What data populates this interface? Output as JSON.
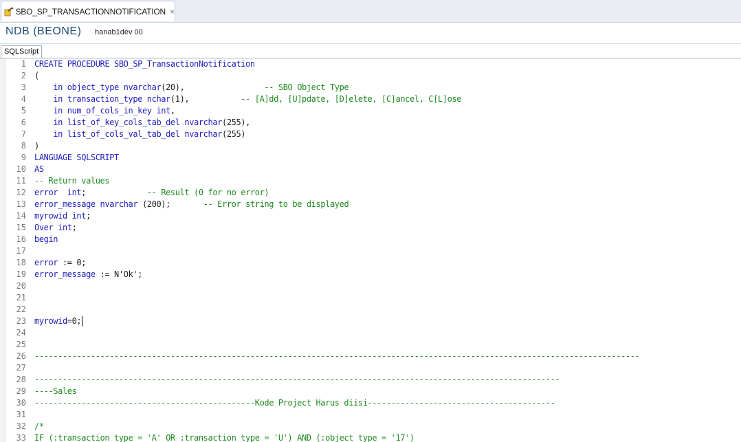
{
  "tab": {
    "title": "SBO_SP_TRANSACTIONNOTIFICATION",
    "close_glyph": "×",
    "icon": "procedure-icon"
  },
  "header": {
    "db_name": "NDB (BEONE)",
    "host": "hanab1dev 00"
  },
  "subtab": {
    "label": "SQLScript"
  },
  "colors": {
    "keyword": "#1f1fc0",
    "comment": "#1f8a1f",
    "text": "#202020",
    "line_number": "#787878",
    "db_name": "#1c4a7a"
  },
  "editor": {
    "cursor_line": 23,
    "lines": [
      {
        "n": "1",
        "segments": [
          {
            "t": "CREATE PROCEDURE SBO_SP_TransactionNotification",
            "c": "kw"
          }
        ]
      },
      {
        "n": "2",
        "segments": [
          {
            "t": "(",
            "c": "tx"
          }
        ]
      },
      {
        "n": "3",
        "segments": [
          {
            "t": "    in object_type nvarchar",
            "c": "kw"
          },
          {
            "t": "(20),                 ",
            "c": "tx"
          },
          {
            "t": "-- SBO Object Type",
            "c": "cm"
          }
        ]
      },
      {
        "n": "4",
        "segments": [
          {
            "t": "    in transaction_type nchar",
            "c": "kw"
          },
          {
            "t": "(1),           ",
            "c": "tx"
          },
          {
            "t": "-- [A]dd, [U]pdate, [D]elete, [C]ancel, C[L]ose",
            "c": "cm"
          }
        ]
      },
      {
        "n": "5",
        "segments": [
          {
            "t": "    in num_of_cols_in_key int",
            "c": "kw"
          },
          {
            "t": ",",
            "c": "tx"
          }
        ]
      },
      {
        "n": "6",
        "segments": [
          {
            "t": "    in list_of_key_cols_tab_del nvarchar",
            "c": "kw"
          },
          {
            "t": "(255),",
            "c": "tx"
          }
        ]
      },
      {
        "n": "7",
        "segments": [
          {
            "t": "    in list_of_cols_val_tab_del nvarchar",
            "c": "kw"
          },
          {
            "t": "(255)",
            "c": "tx"
          }
        ]
      },
      {
        "n": "8",
        "segments": [
          {
            "t": ")",
            "c": "tx"
          }
        ]
      },
      {
        "n": "9",
        "segments": [
          {
            "t": "LANGUAGE SQLSCRIPT",
            "c": "kw"
          }
        ]
      },
      {
        "n": "10",
        "segments": [
          {
            "t": "AS",
            "c": "kw"
          }
        ]
      },
      {
        "n": "11",
        "segments": [
          {
            "t": "-- Return values",
            "c": "cm"
          }
        ]
      },
      {
        "n": "12",
        "segments": [
          {
            "t": "error  int",
            "c": "kw"
          },
          {
            "t": ";             ",
            "c": "tx"
          },
          {
            "t": "-- Result (0 for no error)",
            "c": "cm"
          }
        ]
      },
      {
        "n": "13",
        "segments": [
          {
            "t": "error_message nvarchar",
            "c": "kw"
          },
          {
            "t": " (200);       ",
            "c": "tx"
          },
          {
            "t": "-- Error string to be displayed",
            "c": "cm"
          }
        ]
      },
      {
        "n": "14",
        "segments": [
          {
            "t": "myrowid int",
            "c": "kw"
          },
          {
            "t": ";",
            "c": "tx"
          }
        ]
      },
      {
        "n": "15",
        "segments": [
          {
            "t": "Over int",
            "c": "kw"
          },
          {
            "t": ";",
            "c": "tx"
          }
        ]
      },
      {
        "n": "16",
        "segments": [
          {
            "t": "begin",
            "c": "kw"
          }
        ]
      },
      {
        "n": "17",
        "segments": []
      },
      {
        "n": "18",
        "segments": [
          {
            "t": "error",
            "c": "kw"
          },
          {
            "t": " := 0;",
            "c": "tx"
          }
        ]
      },
      {
        "n": "19",
        "segments": [
          {
            "t": "error_message",
            "c": "kw"
          },
          {
            "t": " := N'Ok';",
            "c": "tx"
          }
        ]
      },
      {
        "n": "20",
        "segments": []
      },
      {
        "n": "21",
        "segments": []
      },
      {
        "n": "22",
        "segments": []
      },
      {
        "n": "23",
        "segments": [
          {
            "t": "myrowid",
            "c": "kw"
          },
          {
            "t": "=0;",
            "c": "tx"
          }
        ]
      },
      {
        "n": "24",
        "segments": []
      },
      {
        "n": "25",
        "segments": []
      },
      {
        "n": "26",
        "segments": [
          {
            "t": "---------------------------------------------------------------------------------------------------------------------------------",
            "c": "cm"
          }
        ]
      },
      {
        "n": "27",
        "segments": []
      },
      {
        "n": "28",
        "segments": [
          {
            "t": "----------------------------------------------------------------------------------------------------------------",
            "c": "cm"
          }
        ]
      },
      {
        "n": "29",
        "segments": [
          {
            "t": "----Sales",
            "c": "cm"
          }
        ]
      },
      {
        "n": "30",
        "segments": [
          {
            "t": "-----------------------------------------------Kode Project Harus diisi----------------------------------------",
            "c": "cm"
          }
        ]
      },
      {
        "n": "31",
        "segments": []
      },
      {
        "n": "32",
        "segments": [
          {
            "t": "/*",
            "c": "cm"
          }
        ]
      },
      {
        "n": "33",
        "segments": [
          {
            "t": "IF (:transaction_type = 'A' OR :transaction_type = 'U') AND (:object_type = '17')",
            "c": "cm"
          }
        ]
      }
    ]
  }
}
